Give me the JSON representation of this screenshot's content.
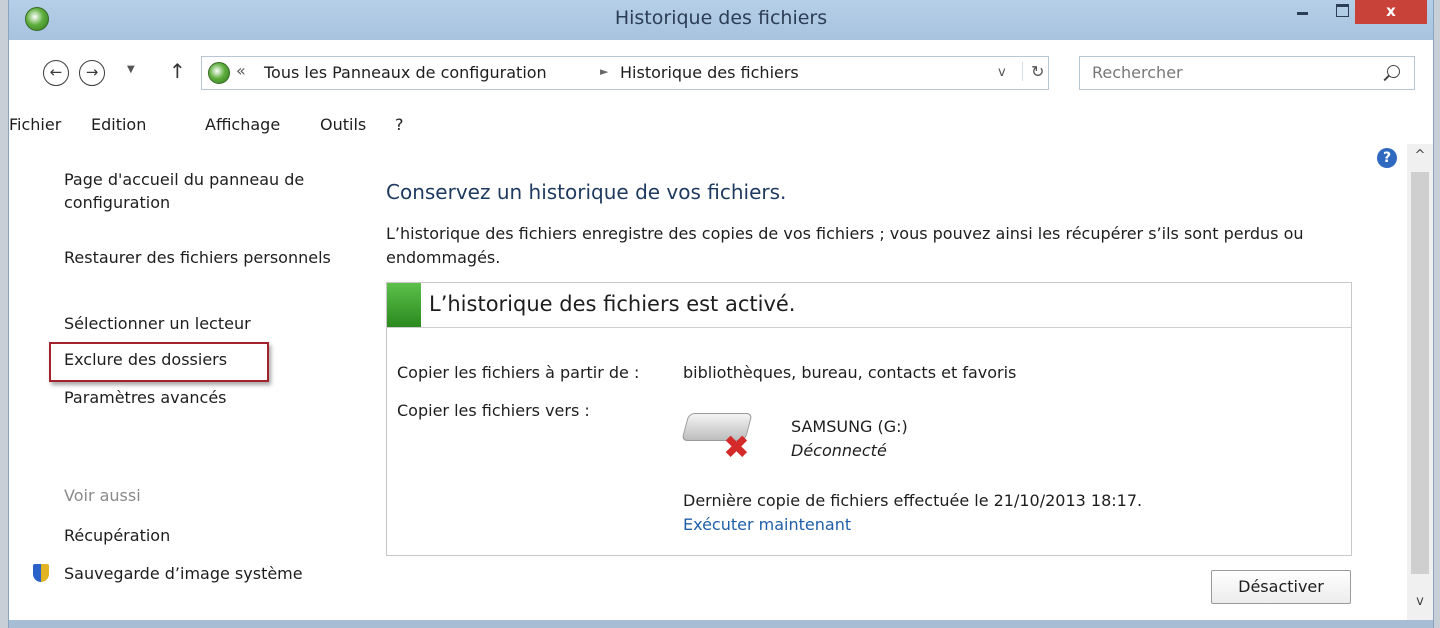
{
  "window": {
    "title": "Historique des fichiers",
    "close_label": "x"
  },
  "nav": {
    "back_glyph": "←",
    "forward_glyph": "→",
    "dropdown_glyph": "▼",
    "up_glyph": "↑"
  },
  "address": {
    "chevrons": "«",
    "crumb1": "Tous les Panneaux de configuration",
    "separator": "►",
    "crumb2": "Historique des fichiers",
    "dropdown_glyph": "v",
    "refresh_glyph": "↻"
  },
  "search": {
    "placeholder": "Rechercher"
  },
  "menu": [
    "Fichier",
    "Edition",
    "Affichage",
    "Outils",
    "?"
  ],
  "sidebar": {
    "tasks": [
      "Page d'accueil du panneau de configuration",
      "Restaurer des fichiers personnels",
      "Sélectionner un lecteur",
      "Exclure des dossiers",
      "Paramètres avancés"
    ],
    "see_also_title": "Voir aussi",
    "see_also": [
      "Récupération",
      "Sauvegarde d’image système"
    ]
  },
  "main": {
    "title": "Conservez un historique de vos fichiers.",
    "description": "L’historique des fichiers enregistre des copies de vos fichiers ; vous pouvez ainsi les récupérer s’ils sont perdus ou endommagés.",
    "status": "L’historique des fichiers est activé.",
    "copy_from_label": "Copier les fichiers à partir de :",
    "copy_from_value": "bibliothèques, bureau, contacts et favoris",
    "copy_to_label": "Copier les fichiers vers :",
    "drive_name": "SAMSUNG (G:)",
    "drive_status": "Déconnecté",
    "last_copy": "Dernière copie de fichiers effectuée le 21/10/2013 18:17.",
    "run_now": "Exécuter maintenant",
    "disable_button": "Désactiver"
  },
  "help": {
    "glyph": "?"
  },
  "scroll": {
    "up_glyph": "^",
    "down_glyph": "v"
  },
  "colors": {
    "titlebar": "#b6cfe8",
    "close": "#c8423a",
    "status_green": "#2b8a1f",
    "link": "#1f5fa8",
    "highlight_red": "#a3232c"
  }
}
